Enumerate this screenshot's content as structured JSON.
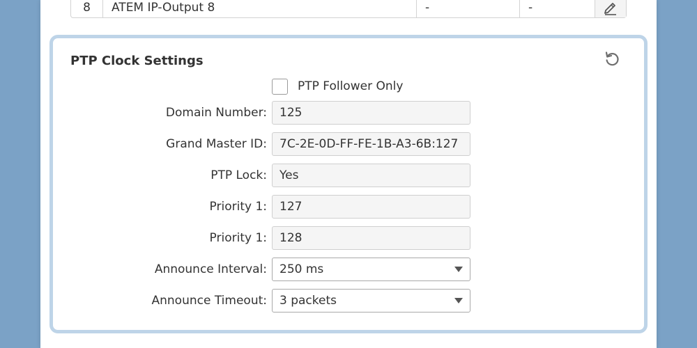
{
  "output_row": {
    "number": "8",
    "name": "ATEM IP-Output 8",
    "col_a": "-",
    "col_b": "-",
    "edit_icon": "pencil-icon"
  },
  "panel": {
    "title": "PTP Clock Settings",
    "reset_icon": "reset-icon",
    "follower_only": {
      "label": "PTP Follower Only",
      "checked": false
    },
    "fields": {
      "domain_number": {
        "label": "Domain Number:",
        "value": "125"
      },
      "grand_master_id": {
        "label": "Grand Master ID:",
        "value": "7C-2E-0D-FF-FE-1B-A3-6B:127"
      },
      "ptp_lock": {
        "label": "PTP Lock:",
        "value": "Yes"
      },
      "priority_1a": {
        "label": "Priority 1:",
        "value": "127"
      },
      "priority_1b": {
        "label": "Priority 1:",
        "value": "128"
      },
      "announce_interval": {
        "label": "Announce Interval:",
        "value": "250 ms"
      },
      "announce_timeout": {
        "label": "Announce Timeout:",
        "value": "3 packets"
      }
    }
  },
  "colors": {
    "background": "#7ba2c6",
    "panel_border": "#bed4e8",
    "field_bg": "#f5f5f5"
  }
}
